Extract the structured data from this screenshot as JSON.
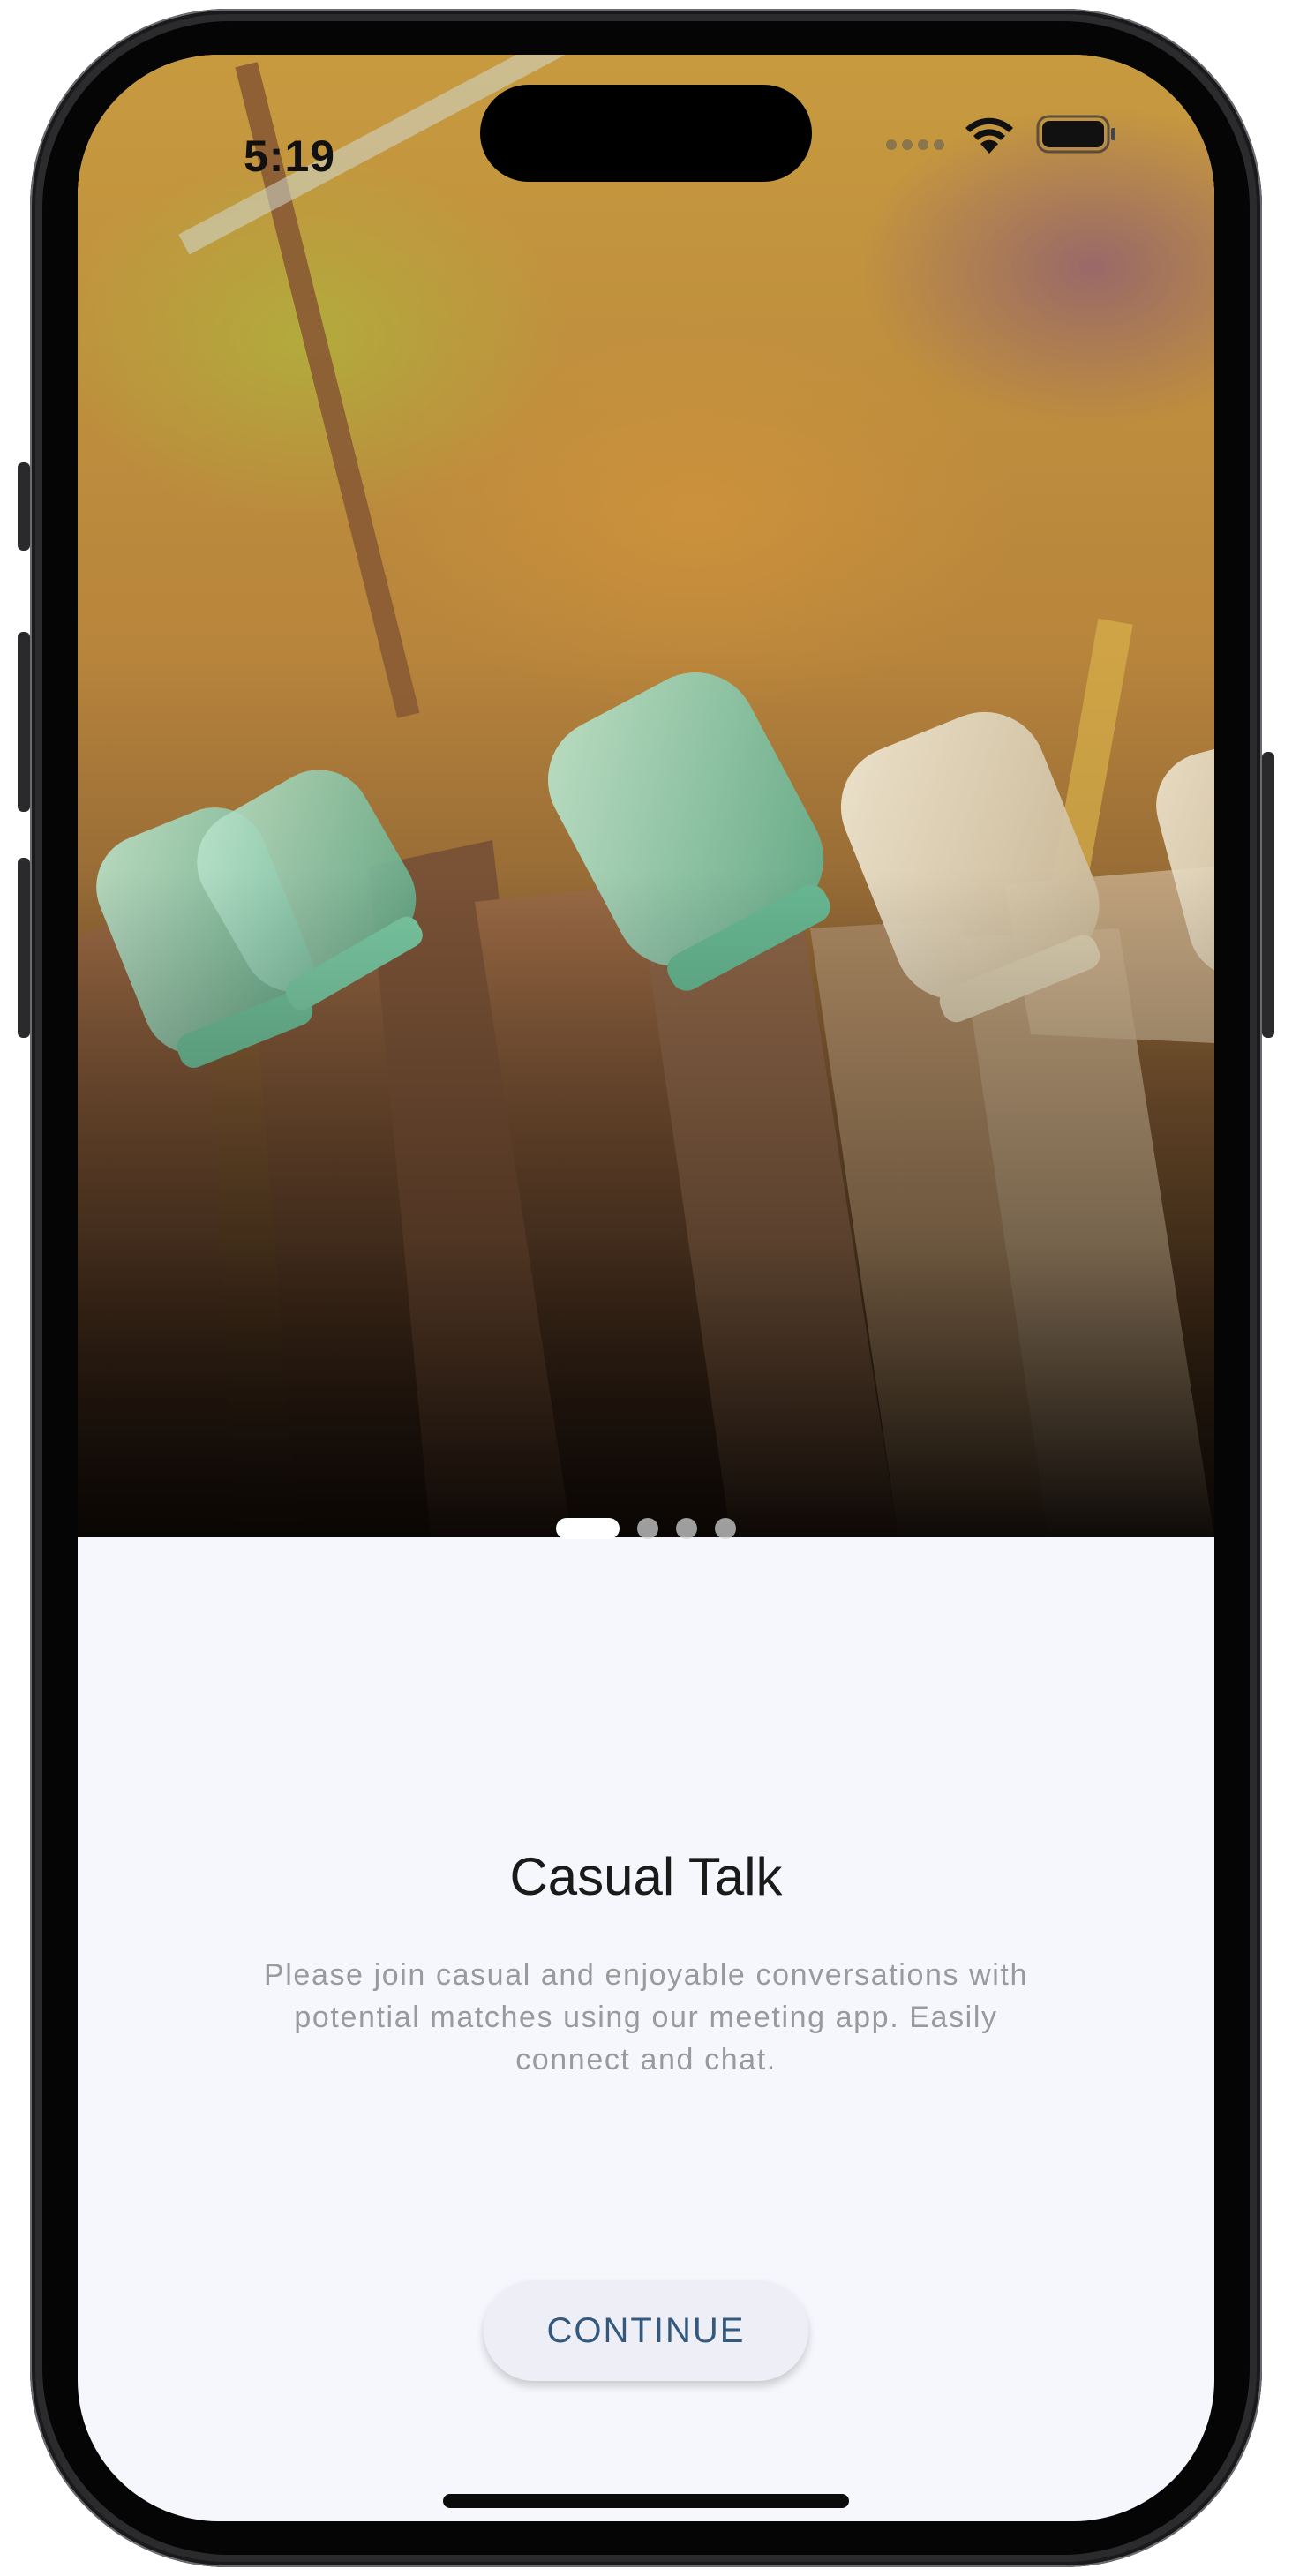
{
  "status_bar": {
    "time": "5:19"
  },
  "hero": {
    "image_description_icon": "photo-of-glass-jars-on-wooden-fence"
  },
  "pager": {
    "total_pages": 4,
    "active_page": 1
  },
  "content": {
    "title": "Casual Talk",
    "description": "Please join casual and enjoyable conversations with potential matches using our meeting app. Easily connect and chat."
  },
  "actions": {
    "continue_label": "CONTINUE"
  },
  "colors": {
    "background": "#f6f7fc",
    "button_text": "#34597f",
    "button_bg": "#eeeff6"
  }
}
